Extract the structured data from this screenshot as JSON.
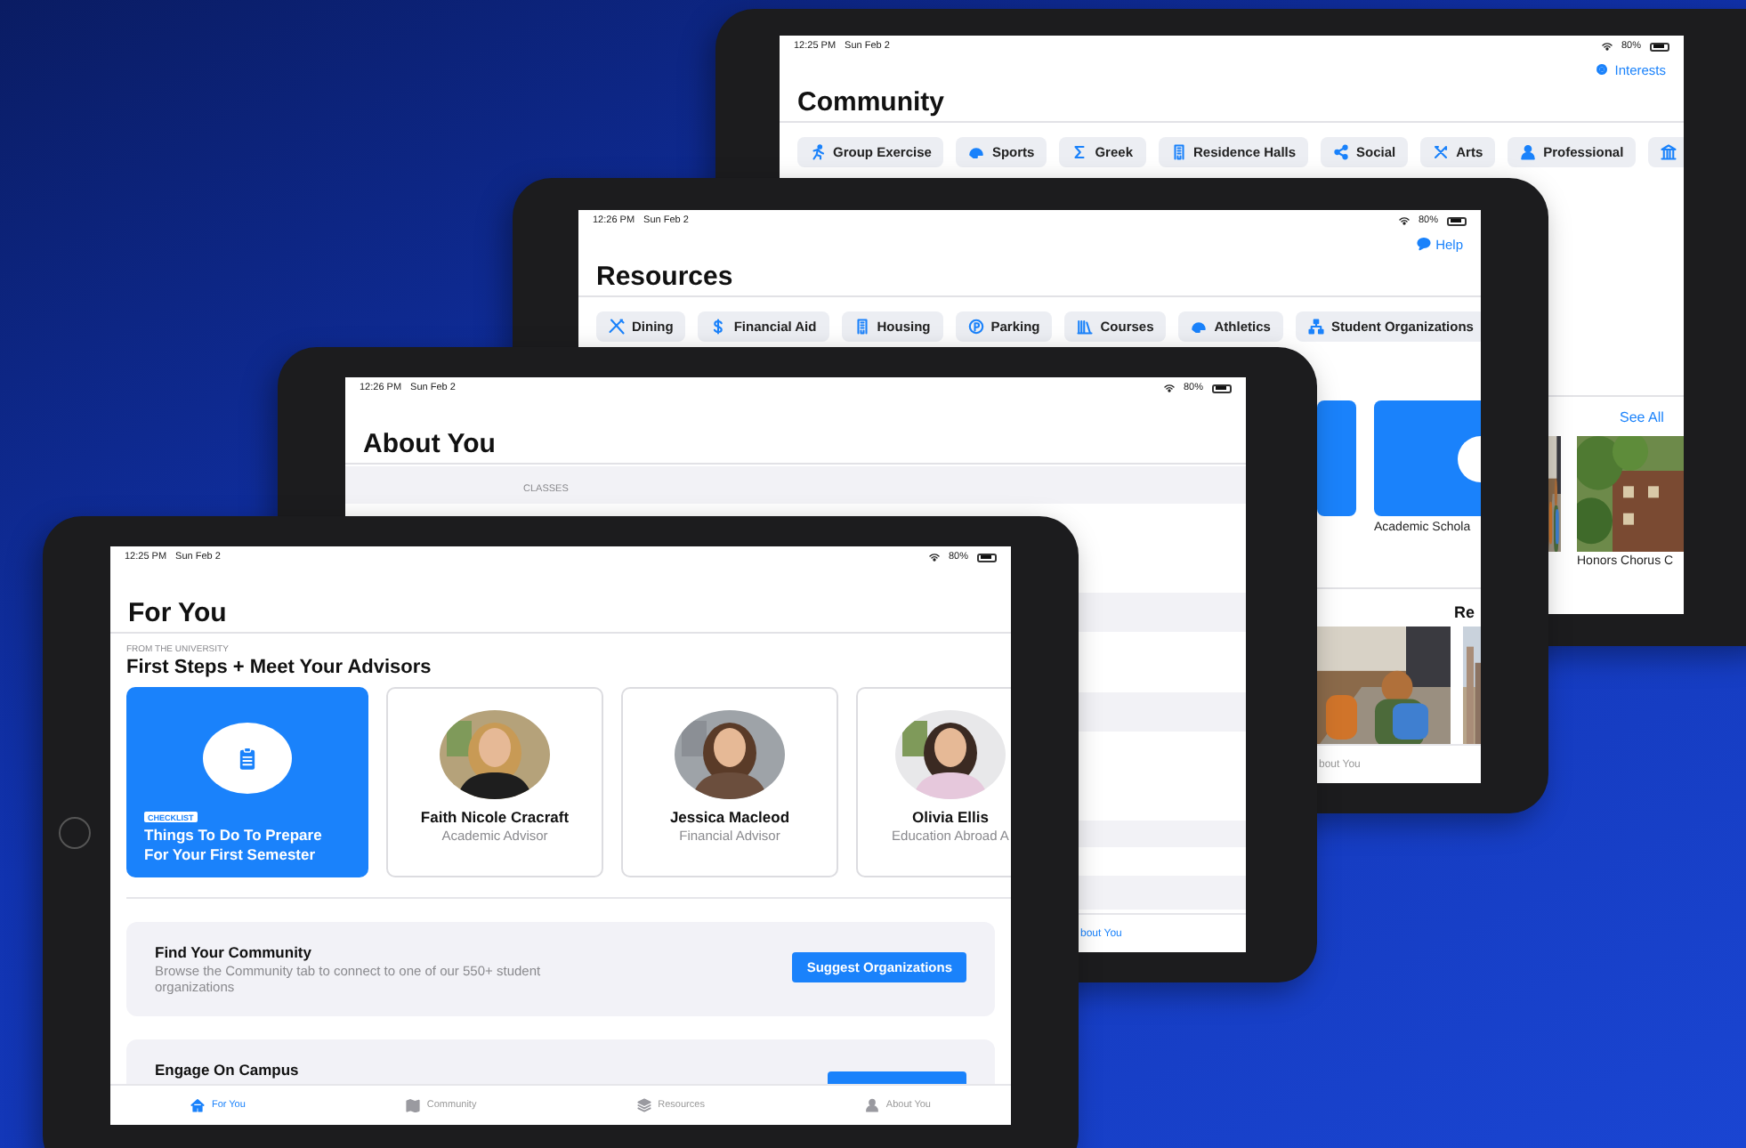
{
  "community_screen": {
    "status_bar": {
      "time": "12:25 PM",
      "date": "Sun Feb 2",
      "battery": "80%"
    },
    "action": "Interests",
    "title": "Community",
    "chips": [
      "Group Exercise",
      "Sports",
      "Greek",
      "Residence Halls",
      "Social",
      "Arts",
      "Professional"
    ],
    "see_all": "See All",
    "event_title": "Honors Chorus C"
  },
  "resources_screen": {
    "status_bar": {
      "time": "12:26 PM",
      "date": "Sun Feb 2",
      "battery": "80%"
    },
    "action": "Help",
    "title": "Resources",
    "chips": [
      "Dining",
      "Financial Aid",
      "Housing",
      "Parking",
      "Courses",
      "Athletics",
      "Student Organizations"
    ],
    "tile_caption": "Academic Schola",
    "section_title": "Re",
    "tabs": [
      {
        "label": "bout You",
        "selected": false
      }
    ]
  },
  "about_you_screen": {
    "status_bar": {
      "time": "12:26 PM",
      "date": "Sun Feb 2",
      "battery": "80%"
    },
    "title": "About You",
    "section_header": "CLASSES",
    "tabs": [
      {
        "label": "bout You",
        "selected": true
      }
    ]
  },
  "for_you_screen": {
    "status_bar": {
      "time": "12:25 PM",
      "date": "Sun Feb 2",
      "battery": "80%"
    },
    "title": "For You",
    "section_label": "FROM THE UNIVERSITY",
    "section_title": "First Steps + Meet Your Advisors",
    "cards": [
      {
        "kind": "checklist",
        "badge": "CHECKLIST",
        "title": "Things To Do To Prepare For Your First Semester"
      },
      {
        "kind": "advisor",
        "name": "Faith Nicole Cracraft",
        "role": "Academic Advisor"
      },
      {
        "kind": "advisor",
        "name": "Jessica Macleod",
        "role": "Financial Advisor"
      },
      {
        "kind": "advisor",
        "name": "Olivia Ellis",
        "role": "Education Abroad A"
      }
    ],
    "panels": [
      {
        "title": "Find Your Community",
        "description": "Browse the Community tab to connect to one of our 550+ student organizations",
        "button": "Suggest Organizations"
      },
      {
        "title": "Engage On Campus"
      }
    ],
    "tabs": [
      {
        "label": "For You",
        "selected": true
      },
      {
        "label": "Community",
        "selected": false
      },
      {
        "label": "Resources",
        "selected": false
      },
      {
        "label": "About You",
        "selected": false
      }
    ]
  }
}
